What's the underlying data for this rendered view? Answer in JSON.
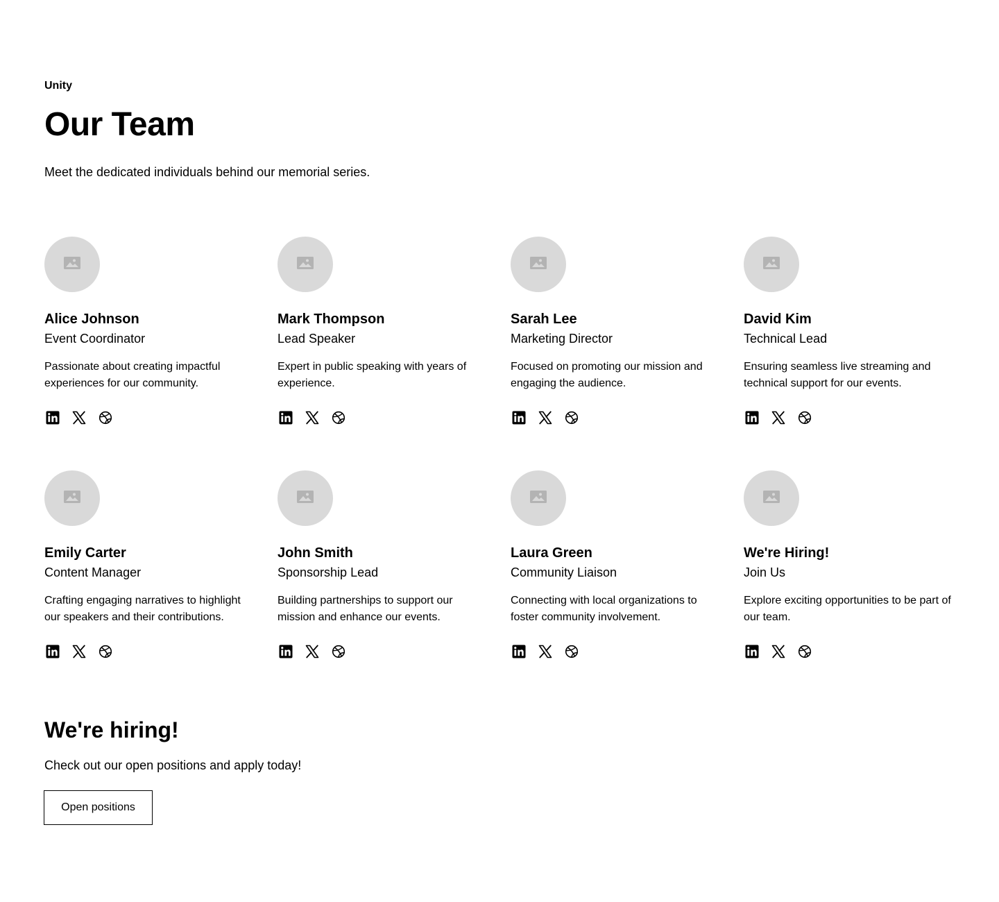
{
  "header": {
    "tagline": "Unity",
    "title": "Our Team",
    "subtitle": "Meet the dedicated individuals behind our memorial series."
  },
  "team": [
    {
      "name": "Alice Johnson",
      "role": "Event Coordinator",
      "bio": "Passionate about creating impactful experiences for our community.",
      "avatar_icon": "image-placeholder-icon",
      "socials": [
        "linkedin-icon",
        "x-icon",
        "dribbble-icon"
      ]
    },
    {
      "name": "Mark Thompson",
      "role": "Lead Speaker",
      "bio": "Expert in public speaking with years of experience.",
      "avatar_icon": "image-placeholder-icon",
      "socials": [
        "linkedin-icon",
        "x-icon",
        "dribbble-icon"
      ]
    },
    {
      "name": "Sarah Lee",
      "role": "Marketing Director",
      "bio": "Focused on promoting our mission and engaging the audience.",
      "avatar_icon": "image-placeholder-icon",
      "socials": [
        "linkedin-icon",
        "x-icon",
        "dribbble-icon"
      ]
    },
    {
      "name": "David Kim",
      "role": "Technical Lead",
      "bio": "Ensuring seamless live streaming and technical support for our events.",
      "avatar_icon": "image-placeholder-icon",
      "socials": [
        "linkedin-icon",
        "x-icon",
        "dribbble-icon"
      ]
    },
    {
      "name": "Emily Carter",
      "role": "Content Manager",
      "bio": "Crafting engaging narratives to highlight our speakers and their contributions.",
      "avatar_icon": "image-placeholder-icon",
      "socials": [
        "linkedin-icon",
        "x-icon",
        "dribbble-icon"
      ]
    },
    {
      "name": "John Smith",
      "role": "Sponsorship Lead",
      "bio": "Building partnerships to support our mission and enhance our events.",
      "avatar_icon": "image-placeholder-icon",
      "socials": [
        "linkedin-icon",
        "x-icon",
        "dribbble-icon"
      ]
    },
    {
      "name": "Laura Green",
      "role": "Community Liaison",
      "bio": "Connecting with local organizations to foster community involvement.",
      "avatar_icon": "image-placeholder-icon",
      "socials": [
        "linkedin-icon",
        "x-icon",
        "dribbble-icon"
      ]
    },
    {
      "name": "We're Hiring!",
      "role": "Join Us",
      "bio": "Explore exciting opportunities to be part of our team.",
      "avatar_icon": "image-placeholder-icon",
      "socials": [
        "linkedin-icon",
        "x-icon",
        "dribbble-icon"
      ]
    }
  ],
  "hiring": {
    "title": "We're hiring!",
    "text": "Check out our open positions and apply today!",
    "button_label": "Open positions"
  },
  "colors": {
    "text": "#000000",
    "background": "#ffffff",
    "avatar_bg": "#d9d9d9",
    "placeholder_icon": "#b3b3b3"
  }
}
